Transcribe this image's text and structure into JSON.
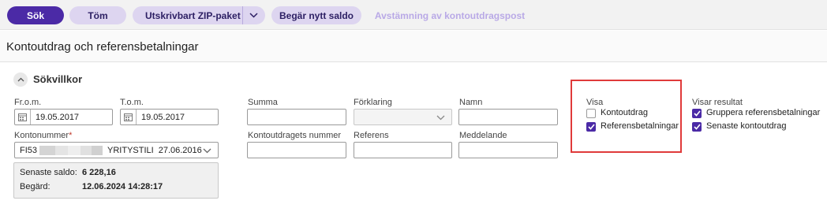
{
  "toolbar": {
    "search_label": "Sök",
    "clear_label": "Töm",
    "zip_label": "Utskrivbart ZIP-paket",
    "request_balance_label": "Begär nytt saldo",
    "reconciliation_label": "Avstämning av kontoutdragspost",
    "accent_color": "#4b2aa6"
  },
  "page": {
    "title": "Kontoutdrag och referensbetalningar"
  },
  "section": {
    "title": "Sökvillkor"
  },
  "form": {
    "from_label": "Fr.o.m.",
    "from_value": "19.05.2017",
    "to_label": "T.o.m.",
    "to_value": "19.05.2017",
    "account_label": "Kontonummer",
    "required_mark": "*",
    "account_prefix": "FI53",
    "account_name": "YRITYSTILI",
    "account_date": "27.06.2016",
    "amount_label": "Summa",
    "explanation_label": "Förklaring",
    "name_label": "Namn",
    "statement_number_label": "Kontoutdragets nummer",
    "reference_label": "Referens",
    "message_label": "Meddelande"
  },
  "info": {
    "latest_balance_label": "Senaste saldo:",
    "latest_balance_value": "6 228,16",
    "requested_label": "Begärd:",
    "requested_value": "12.06.2024 14:28:17"
  },
  "show": {
    "title": "Visa",
    "statement_label": "Kontoutdrag",
    "statement_checked": false,
    "reference_payments_label": "Referensbetalningar",
    "reference_payments_checked": true
  },
  "results": {
    "title": "Visar resultat",
    "group_label": "Gruppera referensbetalningar",
    "group_checked": true,
    "latest_label": "Senaste kontoutdrag",
    "latest_checked": true
  }
}
